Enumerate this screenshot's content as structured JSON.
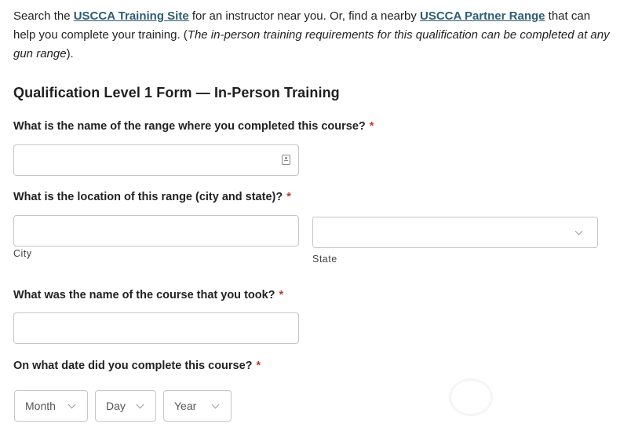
{
  "intro": {
    "t1": "Search the ",
    "link1": "USCCA Training Site",
    "t2": " for an instructor near you. Or, find a nearby ",
    "link2": "USCCA Partner Range",
    "t3": " that can help you complete your training. (",
    "italic": "The in-person training requirements for this qualification can be completed at any gun range",
    "t4": ")."
  },
  "form": {
    "title": "Qualification Level 1 Form — In-Person Training",
    "required_mark": "*",
    "q1": {
      "label": "What is the name of the range where you completed this course?",
      "value": ""
    },
    "q2": {
      "label": "What is the location of this range (city and state)?",
      "city_label": "City",
      "state_label": "State",
      "city_value": "",
      "state_value": ""
    },
    "q3": {
      "label": "What was the name of the course that you took?",
      "value": ""
    },
    "q4": {
      "label": "On what date did you complete this course?",
      "month": "Month",
      "day": "Day",
      "year": "Year"
    }
  }
}
